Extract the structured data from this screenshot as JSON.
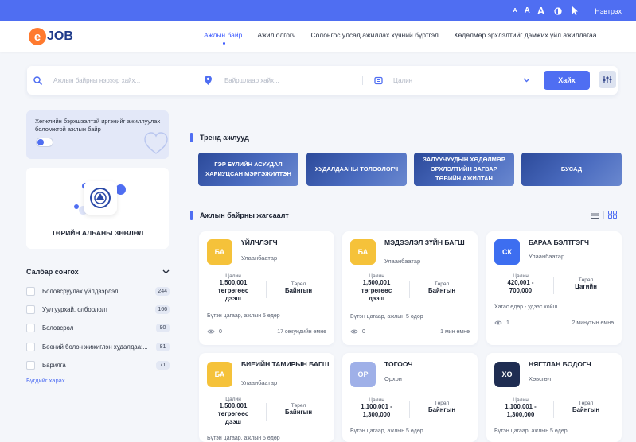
{
  "topbar": {
    "font_small": "A",
    "font_medium": "A",
    "font_large": "A",
    "login": "Нэвтрэх"
  },
  "logo": {
    "mark": "e",
    "text": "JOB"
  },
  "nav": {
    "links": [
      "Ажлын байр",
      "Ажил олгогч",
      "Солонгос улсад ажиллах хүчний бүртгэл",
      "Хөдөлмөр эрхлэлтийг дэмжих үйл ажиллагаа"
    ]
  },
  "search": {
    "keyword_placeholder": "Ажлын байрны нэрээр хайх...",
    "location_placeholder": "Байршлаар хайх...",
    "salary_placeholder": "Цалин",
    "button": "Хайх"
  },
  "promo": {
    "text": "Хөгжлийн бэрхшээлтэй иргэнийг ажиллуулах боломжтой ажлын байр"
  },
  "gov": {
    "title": "ТӨРИЙН АЛБАНЫ ЗӨВЛӨЛ"
  },
  "branches": {
    "heading": "Салбар сонгох",
    "items": [
      {
        "label": "Боловсруулах үйлдвэрлэл",
        "count": "244"
      },
      {
        "label": "Уул уурхай, олборлолт",
        "count": "166"
      },
      {
        "label": "Боловсрол",
        "count": "90"
      },
      {
        "label": "Бөөний болон жижиглэн худалдаа:...",
        "count": "81"
      },
      {
        "label": "Барилга",
        "count": "71"
      }
    ],
    "more": "Бүгдийг харах"
  },
  "trend": {
    "heading": "Тренд ажлууд",
    "items": [
      "ГЭР БҮЛИЙН АСУУДАЛ ХАРИУЦСАН МЭРГЭЖИЛТЭН",
      "ХУДАЛДААНЫ ТӨЛӨӨЛӨГЧ",
      "ЗАЛУУЧУУДЫН ХӨДӨЛМӨР ЭРХЛЭЛТИЙН ЗАГВАР ТӨВИЙН АЖИЛТАН",
      "БУСАД"
    ]
  },
  "jobs": {
    "heading": "Ажлын байрны жагсаалт",
    "salary_key": "Цалин",
    "type_key": "Төрөл",
    "cards": [
      {
        "badge": "БА",
        "color": "#f5c23a",
        "title": "ҮЙЛЧЛЭГЧ",
        "location": "Улаанбаатар",
        "salary": [
          "1,500,001",
          "төгрөгөөс",
          "дээш"
        ],
        "type": "Байнгын",
        "schedule": "Бүтэн цагаар, ажлын 5 өдөр",
        "views": "0",
        "time": "17 секундийн өмнө"
      },
      {
        "badge": "БА",
        "color": "#f5c23a",
        "title": "МЭДЭЭЛЭЛ ЗҮЙН БАГШ",
        "location": "Улаанбаатар",
        "salary": [
          "1,500,001",
          "төгрөгөөс",
          "дээш"
        ],
        "type": "Байнгын",
        "schedule": "Бүтэн цагаар, ажлын 5 өдөр",
        "views": "0",
        "time": "1 мин өмнө"
      },
      {
        "badge": "СК",
        "color": "#3d6ef0",
        "title": "БАРАА БЭЛТГЭГЧ",
        "location": "Улаанбаатар",
        "salary": [
          "420,001 -",
          "700,000"
        ],
        "type": "Цагийн",
        "schedule": "Хагас өдөр - удээс хойш",
        "views": "1",
        "time": "2 минутын өмнө"
      },
      {
        "badge": "БА",
        "color": "#f5c23a",
        "title": "БИЕИЙН ТАМИРЫН БАГШ",
        "location": "Улаанбаатар",
        "salary": [
          "1,500,001",
          "төгрөгөөс",
          "дээш"
        ],
        "type": "Байнгын",
        "schedule": "Бүтэн цагаар, ажлын 5 өдөр"
      },
      {
        "badge": "ОР",
        "color": "#9fb0e8",
        "title": "ТОГООЧ",
        "location": "Орхон",
        "salary": [
          "1,100,001 -",
          "1,300,000"
        ],
        "type": "Байнгын",
        "schedule": "Бүтэн цагаар, ажлын 5 өдөр"
      },
      {
        "badge": "ХӨ",
        "color": "#1f2d52",
        "title": "НЯГТЛАН БОДОГЧ",
        "location": "Хөвсгөл",
        "salary": [
          "1,100,001 -",
          "1,300,000"
        ],
        "type": "Байнгын",
        "schedule": "Бүтэн цагаар, ажлын 5 өдөр"
      }
    ]
  },
  "colors": {
    "accent": "#4f6ef2",
    "brand_orange": "#ff7a2f",
    "brand_navy": "#1e3a8a"
  }
}
